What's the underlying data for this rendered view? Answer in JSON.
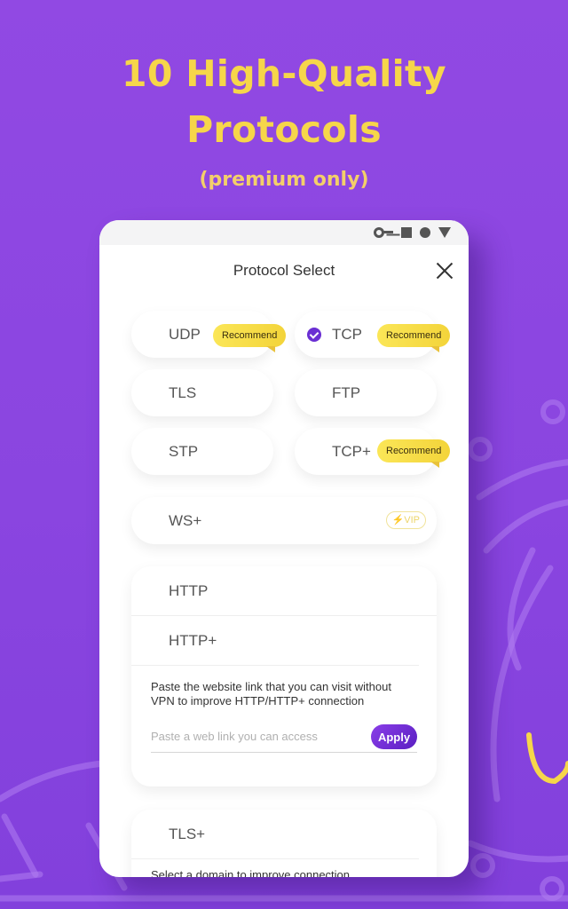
{
  "promo": {
    "headline_line1": "10 High-Quality",
    "headline_line2": "Protocols",
    "subheadline": "(premium only)"
  },
  "colors": {
    "background": "#8a45e0",
    "headline": "#f6d64a",
    "accent": "#6a2fd3",
    "badge": "#f7dd4a"
  },
  "statusbar": {
    "icons": [
      "vpn-key-icon",
      "square-icon",
      "circle-icon",
      "triangle-icon"
    ]
  },
  "dialog": {
    "title": "Protocol Select",
    "close_icon": "close-icon"
  },
  "protocols": [
    {
      "name": "UDP",
      "badge": "Recommend",
      "selected": false
    },
    {
      "name": "TCP",
      "badge": "Recommend",
      "selected": true
    },
    {
      "name": "TLS",
      "badge": "",
      "selected": false
    },
    {
      "name": "FTP",
      "badge": "",
      "selected": false
    },
    {
      "name": "STP",
      "badge": "",
      "selected": false
    },
    {
      "name": "TCP+",
      "badge": "Recommend",
      "selected": false
    },
    {
      "name": "WS+",
      "badge": "VIP",
      "badge_icon": "lightning-icon",
      "selected": false
    }
  ],
  "http_card": {
    "rows": [
      "HTTP",
      "HTTP+"
    ],
    "hint": "Paste the website link that you can visit without VPN to improve HTTP/HTTP+ connection",
    "input_value": "",
    "input_placeholder": "Paste a web link you can access",
    "apply_label": "Apply"
  },
  "tls_card": {
    "rows": [
      "TLS+"
    ],
    "hint_partial": "Select a domain to improve connection"
  }
}
